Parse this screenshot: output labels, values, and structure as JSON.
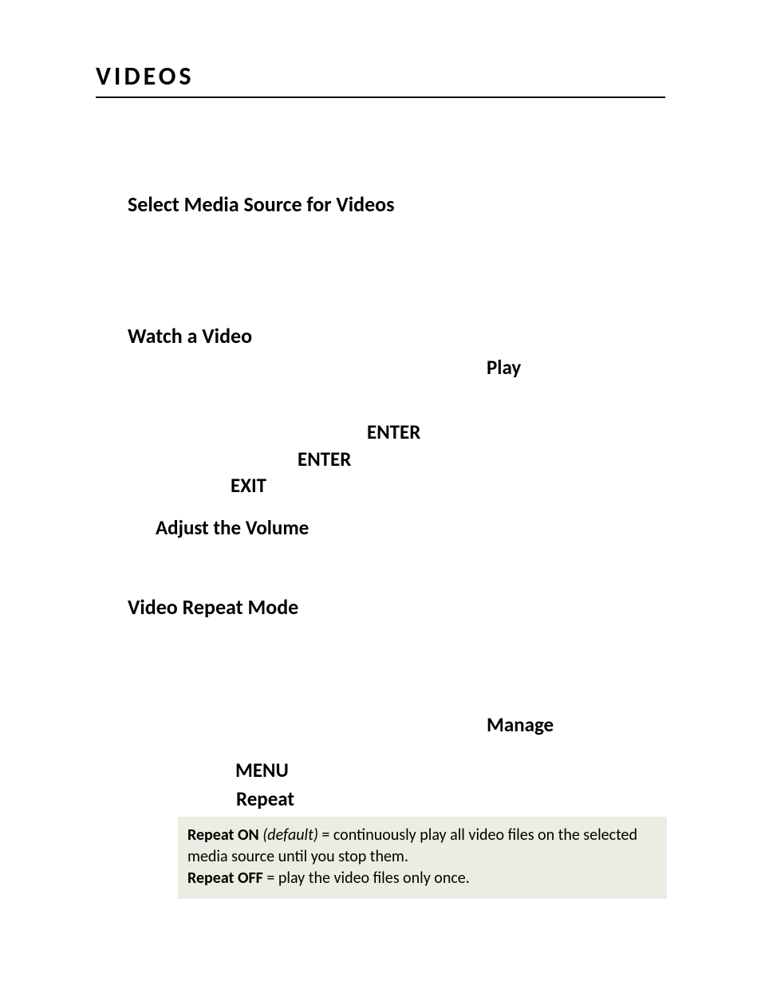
{
  "page": {
    "title": "VIDEOS"
  },
  "sections": {
    "select_media": "Select Media Source for Videos",
    "watch_video": "Watch a Video",
    "adjust_volume": "Adjust the Volume",
    "video_repeat": "Video Repeat Mode"
  },
  "keywords": {
    "play": "Play",
    "enter1": "ENTER",
    "enter2": "ENTER",
    "exit": "EXIT",
    "manage": "Manage",
    "menu": "MENU",
    "repeat": "Repeat"
  },
  "info_box": {
    "repeat_on_label": "Repeat ON",
    "default_label": "(default)",
    "repeat_on_text": " = continuously play all video files on the selected media source until you stop them.",
    "repeat_off_label": "Repeat OFF",
    "repeat_off_text": " = play the video files only once."
  }
}
